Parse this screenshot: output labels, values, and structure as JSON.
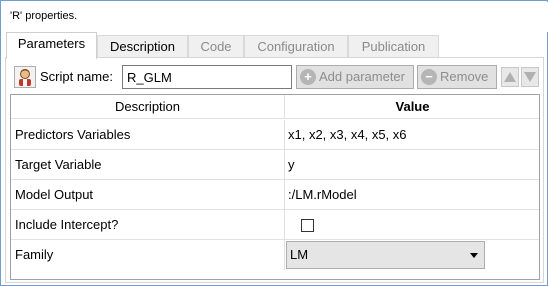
{
  "window": {
    "title": "'R' properties."
  },
  "tabs": [
    {
      "label": "Parameters"
    },
    {
      "label": "Description"
    },
    {
      "label": "Code"
    },
    {
      "label": "Configuration"
    },
    {
      "label": "Publication"
    }
  ],
  "toolbar": {
    "script_name_label": "Script name:",
    "script_name_value": "R_GLM",
    "add_parameter_label": "Add parameter",
    "remove_label": "Remove"
  },
  "grid": {
    "columns": {
      "description": "Description",
      "value": "Value"
    },
    "rows": [
      {
        "description": "Predictors Variables",
        "value": "x1, x2, x3, x4, x5, x6"
      },
      {
        "description": "Target Variable",
        "value": "y"
      },
      {
        "description": "Model Output",
        "value": ":/LM.rModel"
      },
      {
        "description": "Include Intercept?",
        "checked": false
      },
      {
        "description": "Family",
        "value": "LM"
      }
    ]
  }
}
